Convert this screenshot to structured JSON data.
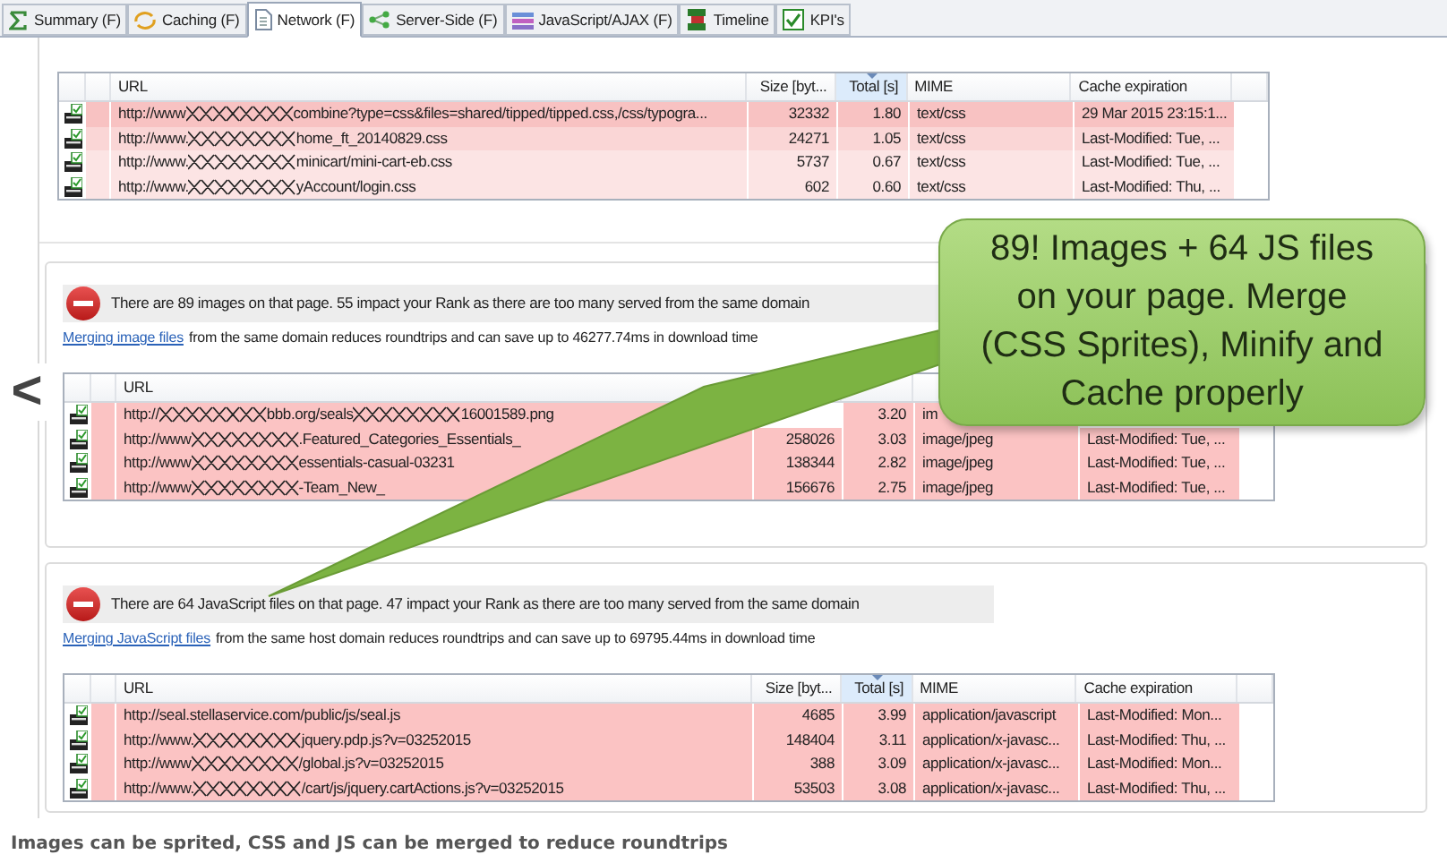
{
  "tabs": [
    {
      "label": "Summary (F)",
      "selected": false
    },
    {
      "label": "Caching (F)",
      "selected": false
    },
    {
      "label": "Network (F)",
      "selected": true
    },
    {
      "label": "Server-Side (F)",
      "selected": false
    },
    {
      "label": "JavaScript/AJAX (F)",
      "selected": false
    },
    {
      "label": "Timeline",
      "selected": false
    },
    {
      "label": "KPI's",
      "selected": false
    }
  ],
  "css_section": {
    "table": {
      "columns": [
        {
          "label": "URL",
          "sorted": false
        },
        {
          "label": "Size [byt...",
          "sorted": false
        },
        {
          "label": "Total [s]",
          "sorted": true
        },
        {
          "label": "MIME",
          "sorted": false
        },
        {
          "label": "Cache expiration",
          "sorted": false
        }
      ],
      "rows": [
        {
          "url": [
            "http://www",
            "combine?type=css&files=shared/tipped/tipped.css,/css/typogra..."
          ],
          "size": "32332",
          "total": "1.80",
          "mime": "text/css",
          "cache": "29 Mar 2015 23:15:1...",
          "color": "#f8c2c2"
        },
        {
          "url": [
            "http://www.",
            "home_ft_20140829.css"
          ],
          "size": "24271",
          "total": "1.05",
          "mime": "text/css",
          "cache": "Last-Modified: Tue, ...",
          "color": "#fad6d6"
        },
        {
          "url": [
            "http://www.",
            "minicart/mini-cart-eb.css"
          ],
          "size": "5737",
          "total": "0.67",
          "mime": "text/css",
          "cache": "Last-Modified: Tue, ...",
          "color": "#fce4e4"
        },
        {
          "url": [
            "http://www.",
            "yAccount/login.css"
          ],
          "size": "602",
          "total": "0.60",
          "mime": "text/css",
          "cache": "Last-Modified: Thu, ...",
          "color": "#fce4e4"
        }
      ]
    }
  },
  "image_section": {
    "message": "There are 89 images on that page. 55 impact your Rank as there are too many served from the same domain",
    "link": "Merging image files",
    "note": "from the same domain reduces roundtrips and can save up to 46277.74ms in download time",
    "table": {
      "columns": [
        {
          "label": "URL",
          "sorted": false
        }
      ],
      "rows": [
        {
          "url": [
            "http://",
            "bbb.org/seals",
            "16001589.png"
          ],
          "total": "3.20",
          "mime": "im",
          "color": "#fbc3c3"
        },
        {
          "url": [
            "http://www",
            ".Featured_Categories_Essentials_"
          ],
          "size": "258026",
          "total": "3.03",
          "mime": "image/jpeg",
          "cache": "Last-Modified: Tue, ...",
          "color": "#fbc3c3"
        },
        {
          "url": [
            "http://www",
            "essentials-casual-03231"
          ],
          "size": "138344",
          "total": "2.82",
          "mime": "image/jpeg",
          "cache": "Last-Modified: Tue, ...",
          "color": "#fbc3c3"
        },
        {
          "url": [
            "http://www",
            "-Team_New_"
          ],
          "size": "156676",
          "total": "2.75",
          "mime": "image/jpeg",
          "cache": "Last-Modified: Tue, ...",
          "color": "#fbc3c3"
        }
      ]
    }
  },
  "js_section": {
    "message": "There are 64 JavaScript files on that page. 47 impact your Rank as there are too many served from the same domain",
    "link": "Merging JavaScript files",
    "note": "from the same host domain reduces roundtrips and can save up to 69795.44ms in download time",
    "table": {
      "columns": [
        {
          "label": "URL",
          "sorted": false
        },
        {
          "label": "Size [byt...",
          "sorted": false
        },
        {
          "label": "Total [s]",
          "sorted": true
        },
        {
          "label": "MIME",
          "sorted": false
        },
        {
          "label": "Cache expiration",
          "sorted": false
        }
      ],
      "rows": [
        {
          "url": [
            "http://seal.stellaservice.com/public/js/seal.js"
          ],
          "size": "4685",
          "total": "3.99",
          "mime": "application/javascript",
          "cache": "Last-Modified: Mon...",
          "color": "#fbc3c3"
        },
        {
          "url": [
            "http://www.",
            "jquery.pdp.js?v=03252015"
          ],
          "size": "148404",
          "total": "3.11",
          "mime": "application/x-javasc...",
          "cache": "Last-Modified: Thu, ...",
          "color": "#fbc3c3"
        },
        {
          "url": [
            "http://www",
            "/global.js?v=03252015"
          ],
          "size": "388",
          "total": "3.09",
          "mime": "application/x-javasc...",
          "cache": "Last-Modified: Mon...",
          "color": "#fbc3c3"
        },
        {
          "url": [
            "http://www.",
            "/cart/js/jquery.cartActions.js?v=03252015"
          ],
          "size": "53503",
          "total": "3.08",
          "mime": "application/x-javasc...",
          "cache": "Last-Modified: Thu, ...",
          "color": "#fbc3c3"
        }
      ]
    }
  },
  "callout": {
    "text": "89! Images + 64 JS files on your page. Merge (CSS Sprites), Minify and Cache properly"
  },
  "nav": {
    "label": "<"
  },
  "caption": "Images can be sprited, CSS and JS can be merged to reduce roundtrips"
}
